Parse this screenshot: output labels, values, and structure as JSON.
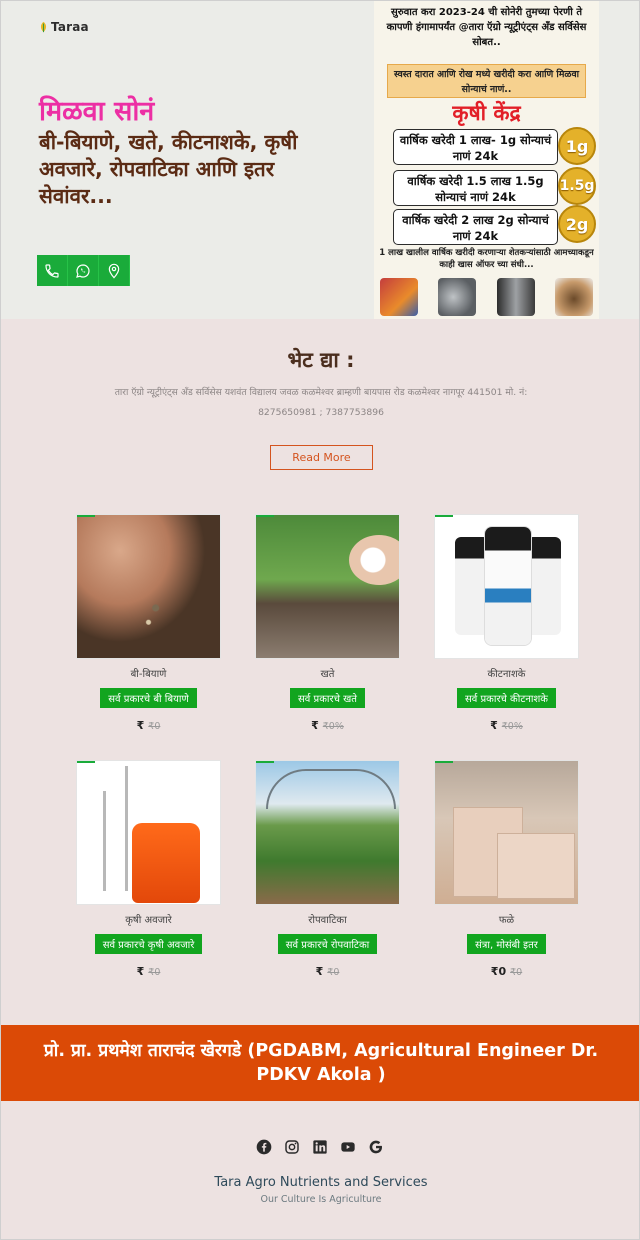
{
  "brand": {
    "logo_text": "Taraa"
  },
  "hero": {
    "title": "मिळवा सोनं",
    "subtitle": "बी-बियाणे, खते, कीटनाशके, कृषी अवजारे, रोपवाटिका आणि इतर सेवांवर...",
    "contact_icons": [
      "phone-icon",
      "whatsapp-icon",
      "location-pin-icon"
    ],
    "accent_color": "#1aab3a"
  },
  "poster": {
    "headline": "सुरुवात करा 2023-24 ची सोनेरी तुमच्या पेरणी ते कापणी हंगामापर्यंत @तारा ऍग्रो न्यूट्रीएंट्स अँड सर्विसेस सोबत..",
    "band_text": "स्वस्त दारात आणि रोख मध्ये खरीदी करा आणि मिळवा सोन्याचं नाणं..",
    "kendra": "कृषी केंद्र",
    "tiers": [
      {
        "text": "वार्षिक खरेदी 1 लाख- 1g सोन्याचं नाणं 24k",
        "coin": "1g"
      },
      {
        "text": "वार्षिक खरेदी 1.5 लाख 1.5g सोन्याचं नाणं 24k",
        "coin": "1.5g"
      },
      {
        "text": "वार्षिक खरेदी 2 लाख 2g सोन्याचं नाणं 24k",
        "coin": "2g"
      }
    ],
    "note": "1 लाख खालील वार्षिक खरीदी करणाऱ्या शेतकऱ्यांसाठी आमच्याकडून काही खास ऑफर च्या संधी..."
  },
  "visit": {
    "title": "भेट द्या :",
    "address": "तारा ऍग्रो न्यूट्रीएंट्स अँड सर्विसेस यशवंत विद्यालय जवळ कळमेश्वर ब्राम्हणी बायपास रोड कळमेश्वर नागपूर 441501 मो. नं:",
    "phones": "8275650981 ; 7387753896",
    "read_more": "Read More"
  },
  "products": [
    {
      "name": "बी-बियाणे",
      "cta": "सर्व प्रकारचे बी बियाणे",
      "price": "₹",
      "old_price": "₹0",
      "image": "seeds-photo"
    },
    {
      "name": "खते",
      "cta": "सर्व प्रकारचे खते",
      "price": "₹",
      "old_price": "₹0%",
      "image": "fertilizer-photo"
    },
    {
      "name": "कीटनाशके",
      "cta": "सर्व प्रकारचे कीटनाशके",
      "price": "₹",
      "old_price": "₹0%",
      "image": "pesticide-bottles-photo"
    },
    {
      "name": "कृषी अवजारे",
      "cta": "सर्व प्रकारचे कृषी अवजारे",
      "price": "₹",
      "old_price": "₹0",
      "image": "sprayer-photo"
    },
    {
      "name": "रोपवाटिका",
      "cta": "सर्व प्रकारचे रोपवाटिका",
      "price": "₹",
      "old_price": "₹0",
      "image": "nursery-photo"
    },
    {
      "name": "फळे",
      "cta": "संत्रा, मोसंबी इतर",
      "price": "₹0",
      "old_price": "₹0",
      "image": "fruit-boxes-photo"
    }
  ],
  "banner": {
    "text": "प्रो. प्रा. प्रथमेश ताराचंद खेरगडे (PGDABM, Agricultural Engineer Dr. PDKV Akola )",
    "color": "#db4a06"
  },
  "footer": {
    "social_icons": [
      "facebook-icon",
      "instagram-icon",
      "linkedin-icon",
      "youtube-icon",
      "google-icon"
    ],
    "company": "Tara Agro Nutrients and Services",
    "tagline": "Our Culture Is Agriculture"
  }
}
